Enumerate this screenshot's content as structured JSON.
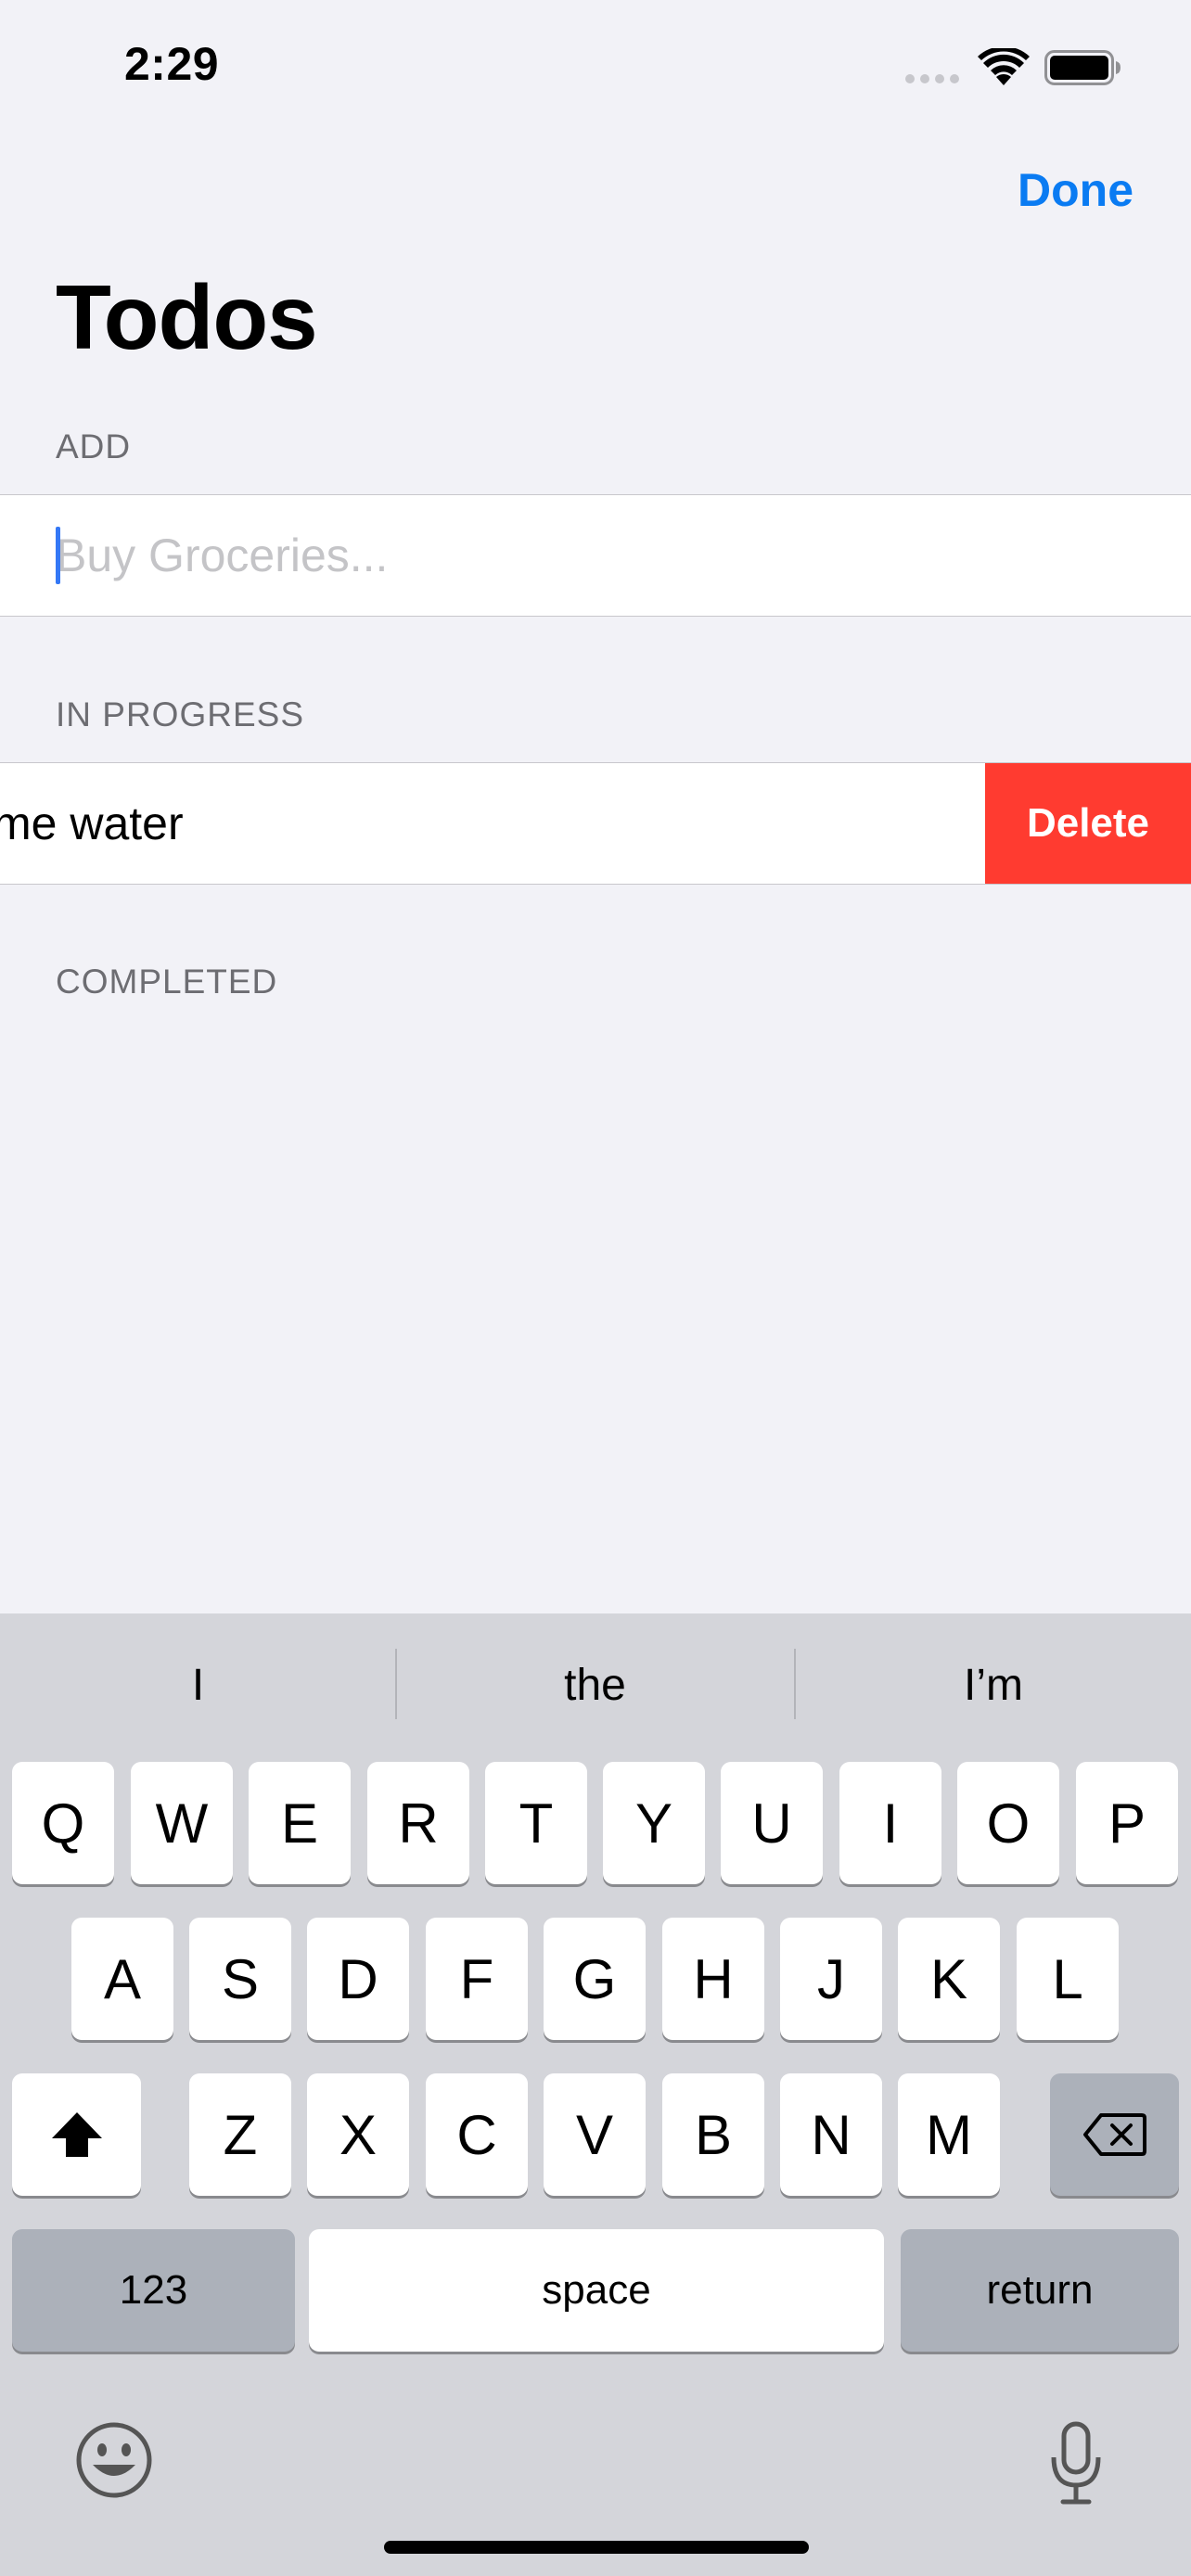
{
  "status_bar": {
    "time": "2:29"
  },
  "nav": {
    "done_label": "Done",
    "title": "Todos"
  },
  "sections": {
    "add_header": "ADD",
    "in_progress_header": "IN PROGRESS",
    "completed_header": "COMPLETED"
  },
  "add": {
    "placeholder": "Buy Groceries...",
    "value": ""
  },
  "in_progress": {
    "items": [
      {
        "text": "me water"
      }
    ],
    "delete_label": "Delete"
  },
  "keyboard": {
    "suggestions": [
      "I",
      "the",
      "I’m"
    ],
    "row1": [
      "Q",
      "W",
      "E",
      "R",
      "T",
      "Y",
      "U",
      "I",
      "O",
      "P"
    ],
    "row2": [
      "A",
      "S",
      "D",
      "F",
      "G",
      "H",
      "J",
      "K",
      "L"
    ],
    "row3": [
      "Z",
      "X",
      "C",
      "V",
      "B",
      "N",
      "M"
    ],
    "numbers_label": "123",
    "space_label": "space",
    "return_label": "return"
  },
  "colors": {
    "accent": "#0a7bf2",
    "delete": "#ff3b30",
    "background": "#f2f2f7"
  },
  "icons": [
    "signal-icon",
    "wifi-icon",
    "battery-icon",
    "shift-icon",
    "backspace-icon",
    "emoji-icon",
    "microphone-icon"
  ]
}
